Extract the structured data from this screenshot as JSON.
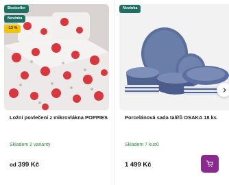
{
  "products": [
    {
      "badges": [
        "Bestseller",
        "Novinka"
      ],
      "discount": "-13 %",
      "title": "Ložní povlečení z mikrovlákna POPPIES",
      "stock": "Skladem 2 varianty",
      "price_prefix": "od",
      "price": "399 Kč",
      "image": "poppies-bedding-image"
    },
    {
      "badges": [
        "Novinka"
      ],
      "title": "Porcelánová sada talířů OSAKA 18 ks",
      "stock": "Skladem 7 kusů",
      "price": "1 499 Kč",
      "image": "blue-porcelain-plates-image"
    }
  ],
  "icons": {
    "cart": "cart-icon",
    "next": "chevron-right-icon"
  },
  "colors": {
    "badge": "#1f6f63",
    "discount": "#f5c400",
    "stock": "#2e8b3e",
    "cart_button": "#8a2a8e"
  }
}
